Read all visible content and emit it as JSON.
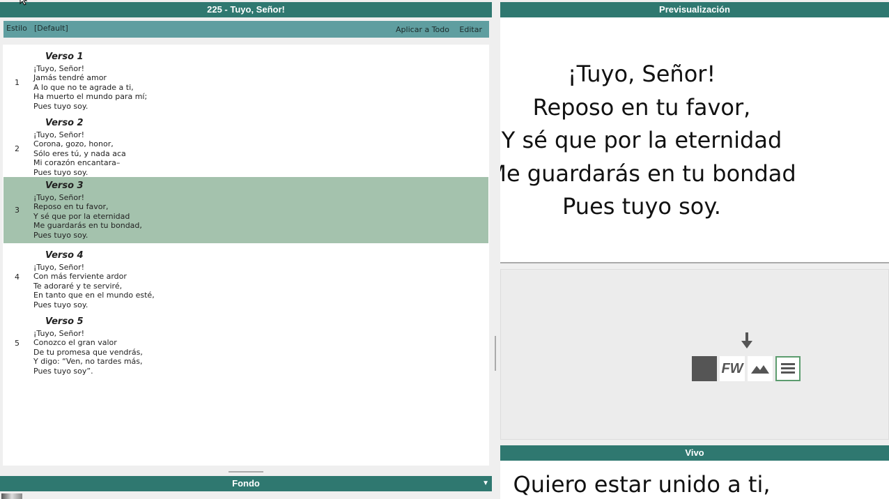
{
  "song": {
    "title": "225 - Tuyo, Señor!",
    "style_label": "Estilo",
    "style_value": "[Default]",
    "apply_all_label": "Aplicar a Todo",
    "edit_label": "Editar"
  },
  "verses": [
    {
      "number": "1",
      "title": "Verso 1",
      "lines": [
        "¡Tuyo, Señor!",
        "Jamás tendré amor",
        "A lo que no te agrade a ti,",
        "Ha muerto el mundo para mí;",
        "Pues tuyo soy."
      ]
    },
    {
      "number": "2",
      "title": "Verso 2",
      "lines": [
        "¡Tuyo, Señor!",
        "Corona, gozo, honor,",
        "Sólo eres tú, y nada aca",
        "Mi corazón encantara–",
        "Pues tuyo soy."
      ]
    },
    {
      "number": "3",
      "title": "Verso 3",
      "lines": [
        "¡Tuyo, Señor!",
        "Reposo en tu favor,",
        "Y sé que por la eternidad",
        "Me guardarás en tu bondad,",
        "Pues tuyo soy."
      ]
    },
    {
      "number": "4",
      "title": "Verso 4",
      "lines": [
        "¡Tuyo, Señor!",
        "Con más ferviente ardor",
        "Te adoraré y te serviré,",
        "En tanto que en el mundo esté,",
        "Pues tuyo soy."
      ]
    },
    {
      "number": "5",
      "title": "Verso 5",
      "lines": [
        "¡Tuyo, Señor!",
        "Conozco el gran valor",
        "De tu promesa que vendrás,",
        "Y digo: “Ven, no tardes más,",
        "Pues tuyo soy”."
      ]
    }
  ],
  "selected_verse": "3",
  "background_panel": {
    "title": "Fondo"
  },
  "preview": {
    "title": "Previsualización",
    "lines": [
      "¡Tuyo, Señor!",
      "Reposo en tu favor,",
      "Y sé que por la eternidad",
      "Me guardarás en tu bondad",
      "Pues tuyo soy."
    ]
  },
  "controls": {
    "fw_label": "FW",
    "icons": [
      "down-arrow-icon",
      "black-screen-icon",
      "fw-logo-icon",
      "image-icon",
      "lyrics-icon"
    ]
  },
  "live": {
    "title": "Vivo",
    "text": "Quiero estar unido a ti,"
  },
  "colors": {
    "header": "#2f7870",
    "style_bar": "#5f9ea0",
    "selected_verse": "#a4c2ad",
    "active_control_border": "#5c9c6e"
  }
}
